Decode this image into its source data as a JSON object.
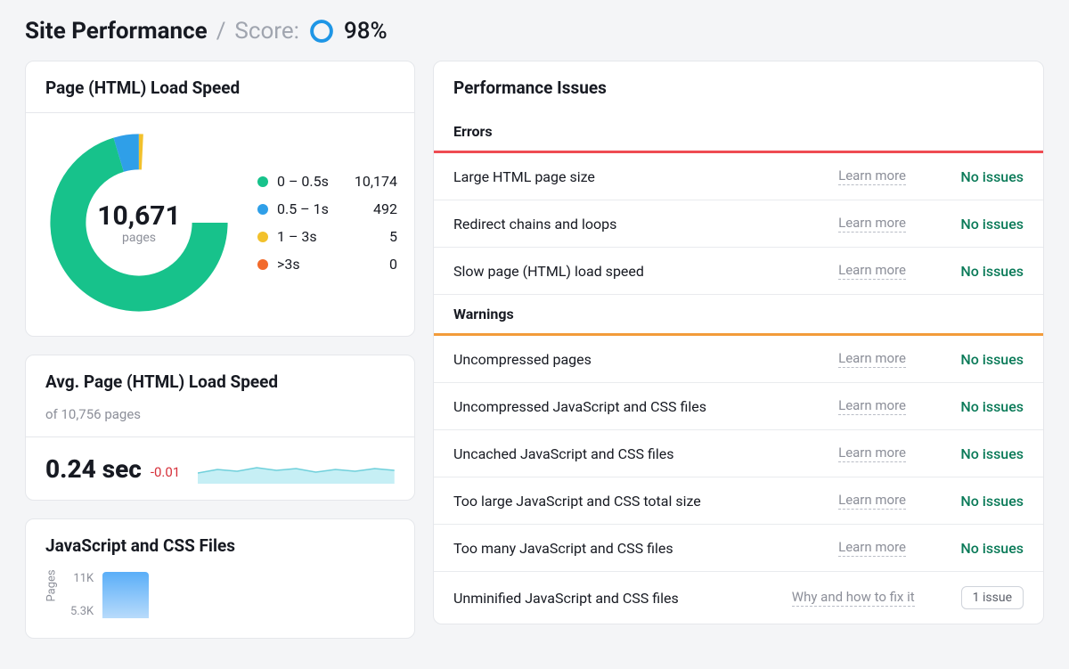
{
  "header": {
    "title": "Site Performance",
    "score_label": "Score:",
    "score_pct": "98%"
  },
  "load_speed": {
    "title": "Page (HTML) Load Speed",
    "total": "10,671",
    "total_label": "pages",
    "legend": [
      {
        "color": "#17c28b",
        "label": "0 – 0.5s",
        "value": "10,174"
      },
      {
        "color": "#2f9fe8",
        "label": "0.5 – 1s",
        "value": "492"
      },
      {
        "color": "#f2c12c",
        "label": "1 – 3s",
        "value": "5"
      },
      {
        "color": "#f26a2b",
        "label": ">3s",
        "value": "0"
      }
    ]
  },
  "avg": {
    "title": "Avg. Page (HTML) Load Speed",
    "subtitle": "of 10,756 pages",
    "value": "0.24 sec",
    "delta": "-0.01"
  },
  "jscss": {
    "title": "JavaScript and CSS Files",
    "yaxis_label": "Pages",
    "ticks": [
      "11K",
      "5.3K"
    ]
  },
  "issues": {
    "title": "Performance Issues",
    "errors_h": "Errors",
    "warnings_h": "Warnings",
    "learn_more": "Learn more",
    "why_fix": "Why and how to fix it",
    "no_issues": "No issues",
    "errors": [
      {
        "name": "Large HTML page size",
        "status": "no"
      },
      {
        "name": "Redirect chains and loops",
        "status": "no"
      },
      {
        "name": "Slow page (HTML) load speed",
        "status": "no"
      }
    ],
    "warnings": [
      {
        "name": "Uncompressed pages",
        "status": "no"
      },
      {
        "name": "Uncompressed JavaScript and CSS files",
        "status": "no"
      },
      {
        "name": "Uncached JavaScript and CSS files",
        "status": "no"
      },
      {
        "name": "Too large JavaScript and CSS total size",
        "status": "no"
      },
      {
        "name": "Too many JavaScript and CSS files",
        "status": "no"
      },
      {
        "name": "Unminified JavaScript and CSS files",
        "status": "issue",
        "badge": "1 issue"
      }
    ]
  },
  "chart_data": {
    "type": "donut",
    "title": "Page (HTML) Load Speed",
    "total_pages": 10671,
    "categories": [
      "0 – 0.5s",
      "0.5 – 1s",
      "1 – 3s",
      ">3s"
    ],
    "values": [
      10174,
      492,
      5,
      0
    ],
    "colors": [
      "#17c28b",
      "#2f9fe8",
      "#f2c12c",
      "#f26a2b"
    ]
  }
}
